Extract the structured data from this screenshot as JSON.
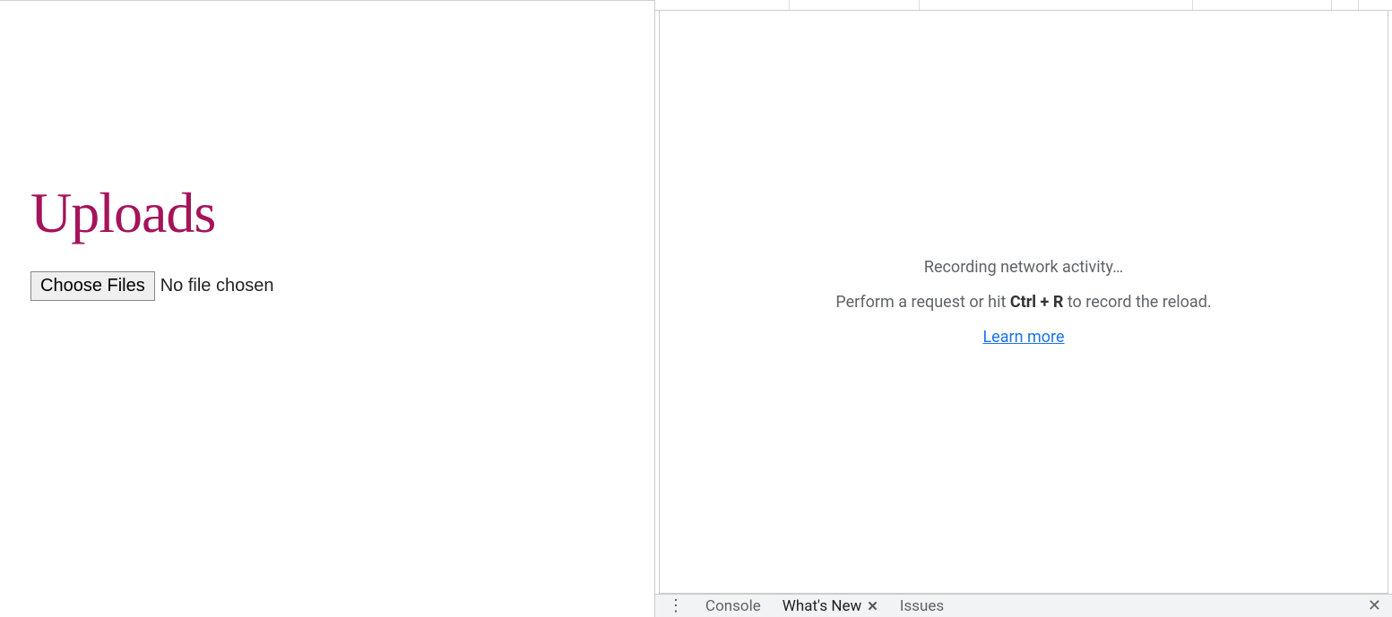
{
  "page": {
    "title": "Uploads",
    "file_input": {
      "button_label": "Choose Files",
      "status_text": "No file chosen"
    }
  },
  "devtools": {
    "network": {
      "columns": [
        150,
        145,
        305,
        155,
        30
      ],
      "empty_state": {
        "recording": "Recording network activity…",
        "instruction_before": "Perform a request or hit ",
        "shortcut": "Ctrl + R",
        "instruction_after": " to record the reload.",
        "learn_more": "Learn more"
      }
    },
    "drawer": {
      "tabs": [
        {
          "label": "Console",
          "active": false,
          "closeable": false
        },
        {
          "label": "What's New",
          "active": true,
          "closeable": true
        },
        {
          "label": "Issues",
          "active": false,
          "closeable": false
        }
      ]
    }
  }
}
